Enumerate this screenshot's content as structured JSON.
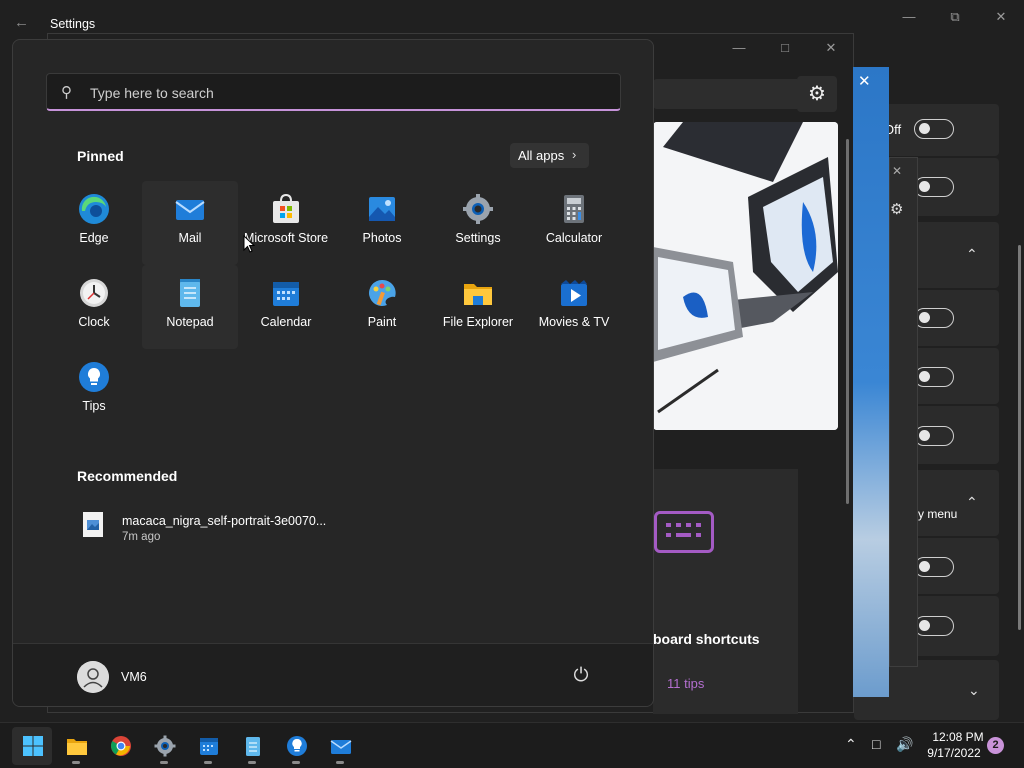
{
  "settings_window": {
    "title": "Settings",
    "rows": [
      {
        "label_fragment": "Off"
      },
      {
        "label_fragment": "y menu"
      }
    ]
  },
  "tips_window": {
    "card_title": "board shortcuts",
    "card_count": "11 tips"
  },
  "start_menu": {
    "search_placeholder": "Type here to search",
    "pinned_label": "Pinned",
    "all_apps_label": "All apps",
    "pinned_apps": [
      {
        "name": "Edge",
        "icon": "edge-icon"
      },
      {
        "name": "Mail",
        "icon": "mail-icon"
      },
      {
        "name": "Microsoft Store",
        "icon": "store-icon"
      },
      {
        "name": "Photos",
        "icon": "photos-icon"
      },
      {
        "name": "Settings",
        "icon": "settings-icon"
      },
      {
        "name": "Calculator",
        "icon": "calculator-icon"
      },
      {
        "name": "Clock",
        "icon": "clock-icon"
      },
      {
        "name": "Notepad",
        "icon": "notepad-icon"
      },
      {
        "name": "Calendar",
        "icon": "calendar-icon"
      },
      {
        "name": "Paint",
        "icon": "paint-icon"
      },
      {
        "name": "File Explorer",
        "icon": "file-explorer-icon"
      },
      {
        "name": "Movies & TV",
        "icon": "movies-tv-icon"
      },
      {
        "name": "Tips",
        "icon": "tips-icon"
      }
    ],
    "recommended_label": "Recommended",
    "recommended_items": [
      {
        "name": "macaca_nigra_self-portrait-3e0070...",
        "time": "7m ago"
      }
    ],
    "user_name": "VM6"
  },
  "taskbar": {
    "apps": [
      "start-icon",
      "file-explorer-icon",
      "chrome-icon",
      "settings-icon",
      "calendar-icon",
      "notepad-icon",
      "tips-icon",
      "mail-icon"
    ],
    "time": "12:08 PM",
    "date": "9/17/2022",
    "notification_count": "2"
  }
}
